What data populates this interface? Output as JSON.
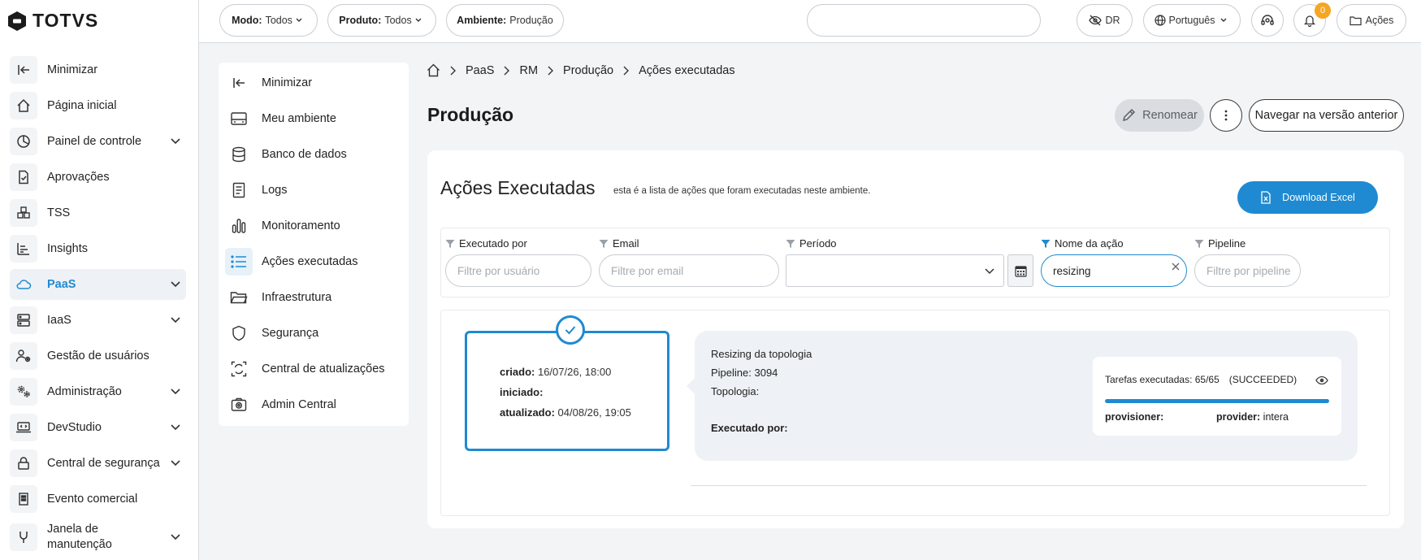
{
  "brand": {
    "name": "TOTVS"
  },
  "sidebar": {
    "items": [
      {
        "label": "Minimizar",
        "icon": "collapse-left-icon",
        "chevron": false
      },
      {
        "label": "Página inicial",
        "icon": "home-icon",
        "chevron": false
      },
      {
        "label": "Painel de controle",
        "icon": "pie-chart-icon",
        "chevron": true
      },
      {
        "label": "Aprovações",
        "icon": "approval-document-icon",
        "chevron": false
      },
      {
        "label": "TSS",
        "icon": "cubes-icon",
        "chevron": false
      },
      {
        "label": "Insights",
        "icon": "bar-list-icon",
        "chevron": false
      },
      {
        "label": "PaaS",
        "icon": "cloud-icon",
        "chevron": true,
        "active": true
      },
      {
        "label": "IaaS",
        "icon": "server-icon",
        "chevron": true
      },
      {
        "label": "Gestão de usuários",
        "icon": "user-gear-icon",
        "chevron": false
      },
      {
        "label": "Administração",
        "icon": "gears-icon",
        "chevron": true
      },
      {
        "label": "DevStudio",
        "icon": "code-laptop-icon",
        "chevron": true
      },
      {
        "label": "Central de segurança",
        "icon": "lock-icon",
        "chevron": true
      },
      {
        "label": "Evento comercial",
        "icon": "building-icon",
        "chevron": false
      },
      {
        "label": "Janela de manutenção",
        "icon": "tools-icon",
        "chevron": true
      }
    ]
  },
  "topbar": {
    "modo": {
      "label": "Modo:",
      "value": "Todos"
    },
    "produto": {
      "label": "Produto:",
      "value": "Todos"
    },
    "ambiente": {
      "label": "Ambiente:",
      "value": "Produção"
    },
    "dr_label": "DR",
    "language": "Português",
    "notifications_count": "0",
    "actions_label": "Ações"
  },
  "submenu": {
    "items": [
      {
        "label": "Minimizar",
        "icon": "collapse-left-icon"
      },
      {
        "label": "Meu ambiente",
        "icon": "environment-icon"
      },
      {
        "label": "Banco de dados",
        "icon": "database-icon"
      },
      {
        "label": "Logs",
        "icon": "log-document-icon"
      },
      {
        "label": "Monitoramento",
        "icon": "bar-chart-icon"
      },
      {
        "label": "Ações executadas",
        "icon": "list-icon",
        "active": true
      },
      {
        "label": "Infraestrutura",
        "icon": "folder-icon"
      },
      {
        "label": "Segurança",
        "icon": "shield-icon"
      },
      {
        "label": "Central de atualizações",
        "icon": "refresh-frame-icon"
      },
      {
        "label": "Admin Central",
        "icon": "camera-gear-icon"
      }
    ]
  },
  "breadcrumb": [
    "PaaS",
    "RM",
    "Produção",
    "Ações executadas"
  ],
  "page": {
    "title": "Produção",
    "rename_label": "Renomear",
    "prev_version_label": "Navegar na versão anterior"
  },
  "card": {
    "title": "Ações Executadas",
    "subtitle": "esta é a lista de ações que foram executadas neste ambiente.",
    "download_label": "Download Excel"
  },
  "filters": {
    "executado_por": {
      "label": "Executado por",
      "placeholder": "Filtre por usuário",
      "value": ""
    },
    "email": {
      "label": "Email",
      "placeholder": "Filtre por email",
      "value": ""
    },
    "periodo": {
      "label": "Período",
      "value": ""
    },
    "nome_acao": {
      "label": "Nome da ação",
      "value": "resizing",
      "active": true
    },
    "pipeline": {
      "label": "Pipeline",
      "placeholder": "Filtre por pipeline",
      "value": ""
    }
  },
  "action": {
    "criado_label": "criado:",
    "criado_value": "16/07/26, 18:00",
    "iniciado_label": "iniciado:",
    "iniciado_value": "",
    "atualizado_label": "atualizado:",
    "atualizado_value": "04/08/26, 19:05",
    "name": "Resizing da topologia",
    "pipeline": "Pipeline: 3094",
    "topologia": "Topologia:",
    "executado_por": "Executado por:",
    "tasks_label": "Tarefas executadas: 65/65",
    "tasks_status": "(SUCCEEDED)",
    "progress": 1.0,
    "provisioner_label": "provisioner:",
    "provisioner_value": "",
    "provider_label": "provider:",
    "provider_value": "intera"
  },
  "colors": {
    "accent": "#1f8ad1",
    "badge": "#f5a623"
  }
}
